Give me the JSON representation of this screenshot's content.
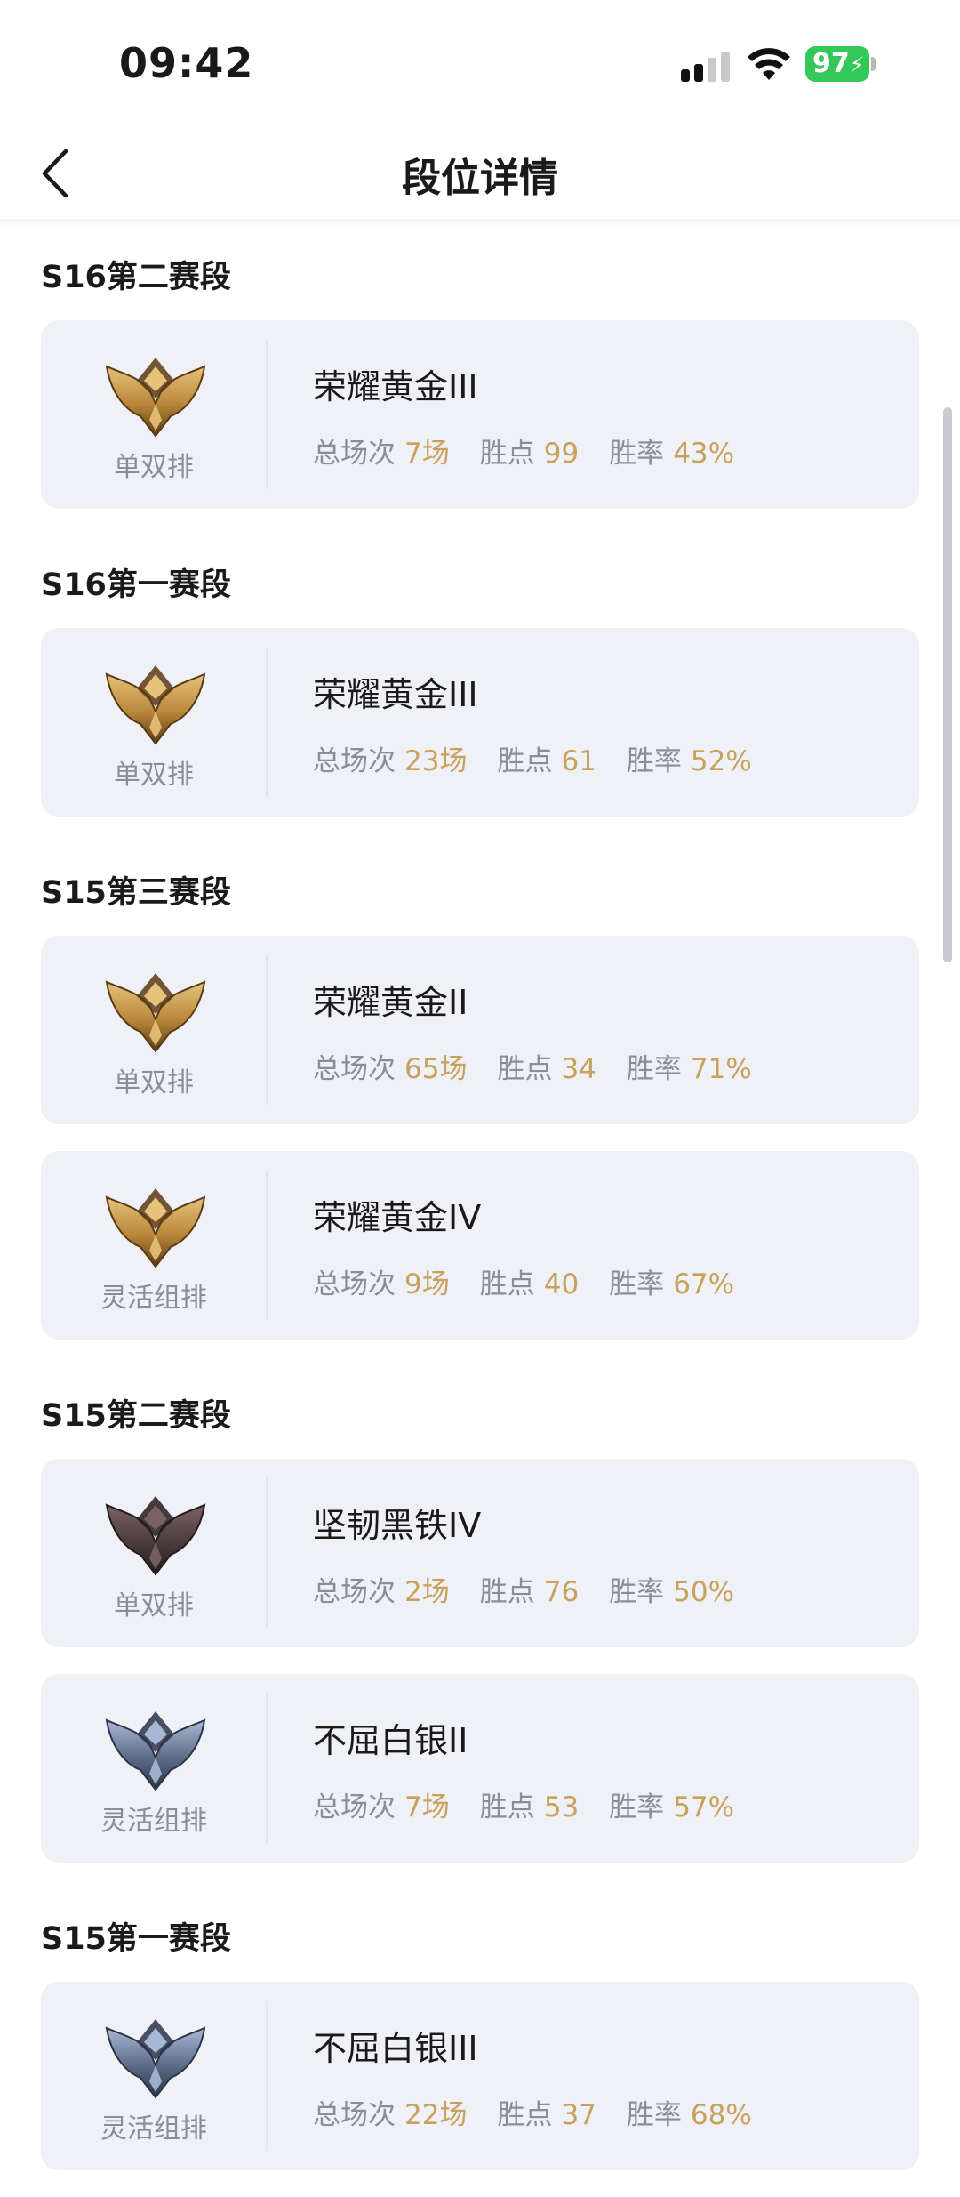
{
  "status_bar": {
    "time": "09:42",
    "battery": "97"
  },
  "nav": {
    "title": "段位详情"
  },
  "stat_labels": {
    "games": "总场次",
    "points": "胜点",
    "winrate": "胜率"
  },
  "seasons": [
    {
      "title": "S16第二赛段",
      "cards": [
        {
          "queue": "单双排",
          "rank": "荣耀黄金III",
          "tier_icon": "gold-emblem-icon",
          "games": "7场",
          "points": "99",
          "winrate": "43%"
        }
      ]
    },
    {
      "title": "S16第一赛段",
      "cards": [
        {
          "queue": "单双排",
          "rank": "荣耀黄金III",
          "tier_icon": "gold-emblem-icon",
          "games": "23场",
          "points": "61",
          "winrate": "52%"
        }
      ]
    },
    {
      "title": "S15第三赛段",
      "cards": [
        {
          "queue": "单双排",
          "rank": "荣耀黄金II",
          "tier_icon": "gold-emblem-icon",
          "games": "65场",
          "points": "34",
          "winrate": "71%"
        },
        {
          "queue": "灵活组排",
          "rank": "荣耀黄金IV",
          "tier_icon": "gold-emblem-icon",
          "games": "9场",
          "points": "40",
          "winrate": "67%"
        }
      ]
    },
    {
      "title": "S15第二赛段",
      "cards": [
        {
          "queue": "单双排",
          "rank": "坚韧黑铁IV",
          "tier_icon": "iron-emblem-icon",
          "games": "2场",
          "points": "76",
          "winrate": "50%"
        },
        {
          "queue": "灵活组排",
          "rank": "不屈白银II",
          "tier_icon": "silver-emblem-icon",
          "games": "7场",
          "points": "53",
          "winrate": "57%"
        }
      ]
    },
    {
      "title": "S15第一赛段",
      "cards": [
        {
          "queue": "灵活组排",
          "rank": "不屈白银III",
          "tier_icon": "silver-emblem-icon",
          "games": "22场",
          "points": "37",
          "winrate": "68%"
        }
      ]
    }
  ],
  "colors": {
    "accent": "#c7a15d",
    "card_bg": "#eff1f6",
    "battery": "#34c759",
    "gold": "#b8863a",
    "iron": "#4a3a3c",
    "silver": "#5b6b86"
  }
}
